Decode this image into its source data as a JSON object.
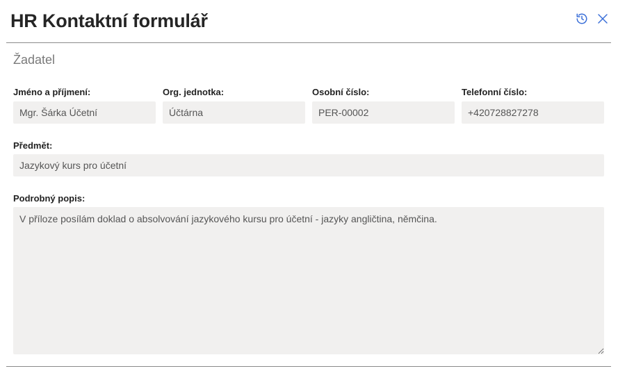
{
  "dialog": {
    "title": "HR Kontaktní formulář",
    "icons": {
      "history": "history-icon",
      "close": "close-icon"
    },
    "accent_color": "#3a6fd8"
  },
  "section": {
    "title": "Žadatel"
  },
  "fields": {
    "name": {
      "label": "Jméno a příjmení:",
      "value": "Mgr. Šárka Účetní"
    },
    "org_unit": {
      "label": "Org. jednotka:",
      "value": "Účtárna"
    },
    "personal_number": {
      "label": "Osobní číslo:",
      "value": "PER-00002"
    },
    "phone": {
      "label": "Telefonní číslo:",
      "value": "+420728827278"
    },
    "subject": {
      "label": "Předmět:",
      "value": "Jazykový kurs pro účetní"
    },
    "description": {
      "label": "Podrobný popis:",
      "value": "V příloze posílám doklad o absolvování jazykového kursu pro účetní - jazyky angličtina, němčina."
    }
  }
}
